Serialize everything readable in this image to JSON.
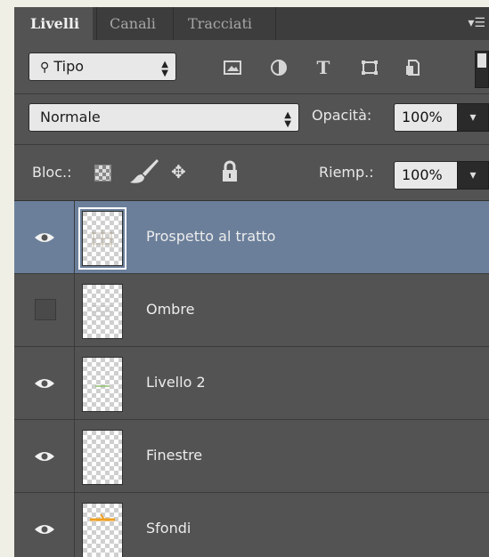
{
  "tabs": [
    {
      "label": "Livelli",
      "active": true
    },
    {
      "label": "Canali",
      "active": false
    },
    {
      "label": "Tracciati",
      "active": false
    }
  ],
  "panel_menu_icon": "panel-menu-icon",
  "filter": {
    "selected": "Tipo",
    "icons": [
      "image-filter-icon",
      "adjustment-filter-icon",
      "text-filter-icon",
      "shape-filter-icon",
      "smart-object-filter-icon"
    ],
    "text_icon_glyph": "T"
  },
  "blend": {
    "mode": "Normale",
    "opacity_label": "Opacità:",
    "opacity_value": "100%"
  },
  "lock": {
    "label": "Bloc.:",
    "icons": [
      "lock-transparency-icon",
      "lock-brush-icon",
      "lock-move-icon",
      "lock-all-icon"
    ],
    "fill_label": "Riemp.:",
    "fill_value": "100%"
  },
  "layers": [
    {
      "name": "Prospetto al tratto",
      "visible": true,
      "selected": true
    },
    {
      "name": "Ombre",
      "visible": false,
      "selected": false
    },
    {
      "name": "Livello 2",
      "visible": true,
      "selected": false
    },
    {
      "name": "Finestre",
      "visible": true,
      "selected": false
    },
    {
      "name": "Sfondi",
      "visible": true,
      "selected": false
    }
  ],
  "colors": {
    "panel": "#535353",
    "selected_layer": "#6b7f9a",
    "tab_bar": "#3d3d3d"
  }
}
